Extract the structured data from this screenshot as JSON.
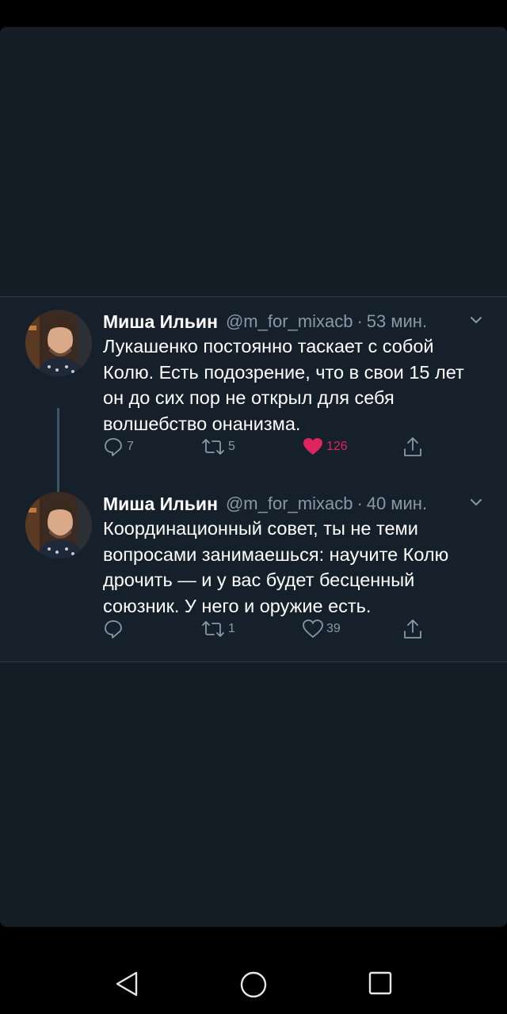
{
  "tweets": [
    {
      "author_name": "Миша Ильин",
      "handle": "@m_for_mixacb",
      "separator": "·",
      "time": "53 мин.",
      "text": "Лукашенко постоянно таскает с собой Колю. Есть подозрение, что в свои 15 лет он до сих пор не открыл для себя волшебство онанизма.",
      "replies": "7",
      "retweets": "5",
      "likes": "126",
      "liked": true
    },
    {
      "author_name": "Миша Ильин",
      "handle": "@m_for_mixacb",
      "separator": "·",
      "time": "40 мин.",
      "text": "Координационный совет, ты не теми вопросами занимаешься: научите Колю дрочить — и у вас будет бесценный союзник. У него и оружие есть.",
      "replies": "",
      "retweets": "1",
      "likes": "39",
      "liked": false
    }
  ],
  "icons": {
    "reply": "reply-icon",
    "retweet": "retweet-icon",
    "like": "heart-icon",
    "share": "share-icon",
    "menu": "chevron-down-icon",
    "nav_back": "back-triangle-icon",
    "nav_home": "home-circle-icon",
    "nav_recents": "recents-square-icon"
  },
  "colors": {
    "background": "#15202b",
    "text": "#ffffff",
    "secondary_text": "#8899a6",
    "like_accent": "#e0245e",
    "divider": "#2b3a4a"
  }
}
